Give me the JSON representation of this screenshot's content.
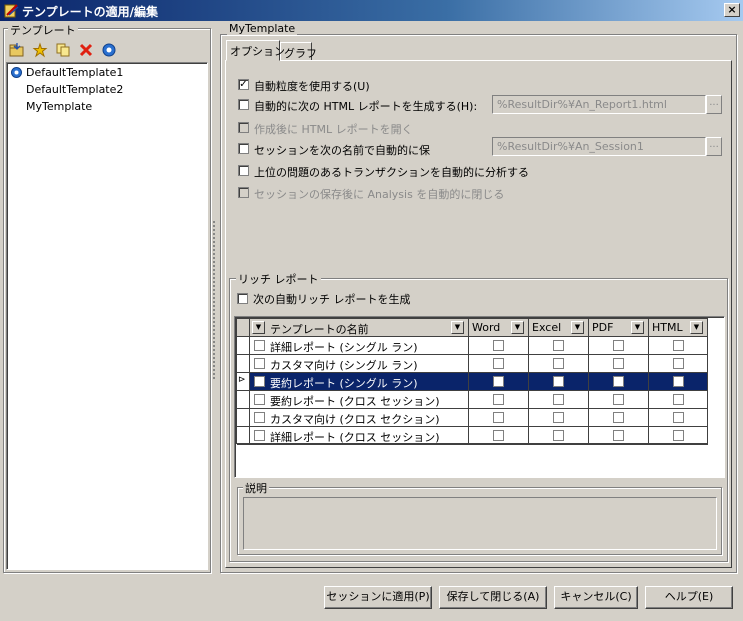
{
  "window": {
    "title": "テンプレートの適用/編集",
    "close_label": "×"
  },
  "templates_panel": {
    "legend": "テンプレート",
    "toolbar": [
      {
        "icon": "open-folder-icon"
      },
      {
        "icon": "new-star-icon"
      },
      {
        "icon": "copy-icon"
      },
      {
        "icon": "delete-x-icon"
      },
      {
        "icon": "settings-gear-icon"
      }
    ],
    "items": [
      {
        "label": "DefaultTemplate1",
        "active": true
      },
      {
        "label": "DefaultTemplate2",
        "active": false
      },
      {
        "label": "MyTemplate",
        "active": false
      }
    ]
  },
  "editor": {
    "legend": "MyTemplate",
    "tabs": [
      {
        "label": "オプション",
        "active": true
      },
      {
        "label": "グラフ",
        "active": false
      }
    ],
    "options": [
      {
        "label": "自動粒度を使用する(U)",
        "checked": true,
        "enabled": true
      },
      {
        "label": "自動的に次の HTML レポートを生成する(H):",
        "checked": false,
        "enabled": true,
        "path": "%ResultDir%¥An_Report1.html"
      },
      {
        "label": "作成後に HTML レポートを開く",
        "checked": false,
        "enabled": false
      },
      {
        "label": "セッションを次の名前で自動的に保",
        "checked": false,
        "enabled": true,
        "path": "%ResultDir%¥An_Session1"
      },
      {
        "label": "上位の問題のあるトランザクションを自動的に分析する",
        "checked": false,
        "enabled": true
      },
      {
        "label": "セッションの保存後に Analysis を自動的に閉じる",
        "checked": false,
        "enabled": false
      }
    ],
    "browse_label": "...",
    "rich_report": {
      "legend": "リッチ レポート",
      "auto_generate_label": "次の自動リッチ レポートを生成",
      "columns": [
        "テンプレートの名前",
        "Word",
        "Excel",
        "PDF",
        "HTML"
      ],
      "rows": [
        {
          "name": "詳細レポート (シングル ラン)",
          "selected": false
        },
        {
          "name": "カスタマ向け (シングル ラン)",
          "selected": false
        },
        {
          "name": "要約レポート (シングル ラン)",
          "selected": true
        },
        {
          "name": "要約レポート (クロス セッション)",
          "selected": false
        },
        {
          "name": "カスタマ向け (クロス セクション)",
          "selected": false
        },
        {
          "name": "詳細レポート (クロス セッション)",
          "selected": false
        }
      ],
      "row_marker": "⊳",
      "description_legend": "説明"
    }
  },
  "buttons": {
    "apply": "セッションに適用(P)",
    "save_close": "保存して閉じる(A)",
    "cancel": "キャンセル(C)",
    "help": "ヘルプ(E)"
  }
}
